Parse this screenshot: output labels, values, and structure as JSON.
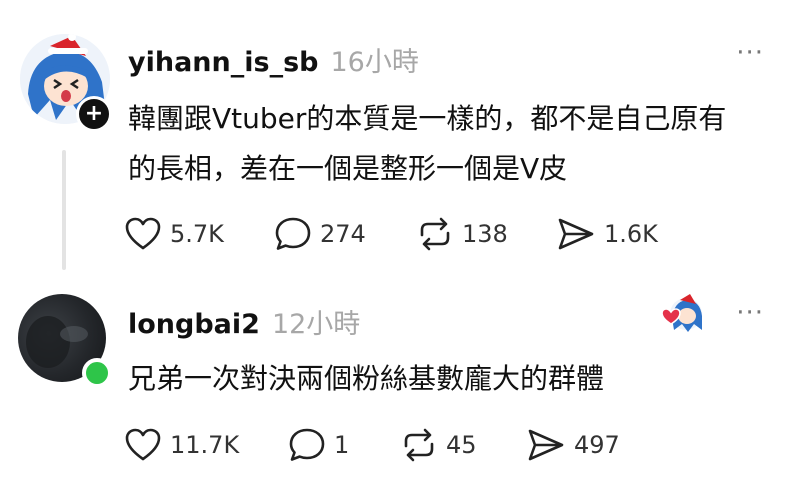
{
  "posts": [
    {
      "username": "yihann_is_sb",
      "timestamp": "16小時",
      "content_lines": [
        "韓團跟Vtuber的本質是一樣的，都不是自己原有",
        "的長相，差在一個是整形一個是V皮"
      ],
      "likes": "5.7K",
      "replies": "274",
      "reposts": "138",
      "shares": "1.6K",
      "more_label": "···"
    },
    {
      "username": "longbai2",
      "timestamp": "12小時",
      "content_lines": [
        "兄弟一次對決兩個粉絲基數龐大的群體"
      ],
      "likes": "11.7K",
      "replies": "1",
      "reposts": "45",
      "shares": "497",
      "more_label": "···"
    }
  ],
  "follow_badge": "+",
  "colors": {
    "online": "#2ec549",
    "timestamp": "#a7a7a7",
    "like_red": "#e4324a"
  },
  "icons": [
    "heart-icon",
    "comment-icon",
    "repost-icon",
    "share-icon",
    "more-icon"
  ]
}
